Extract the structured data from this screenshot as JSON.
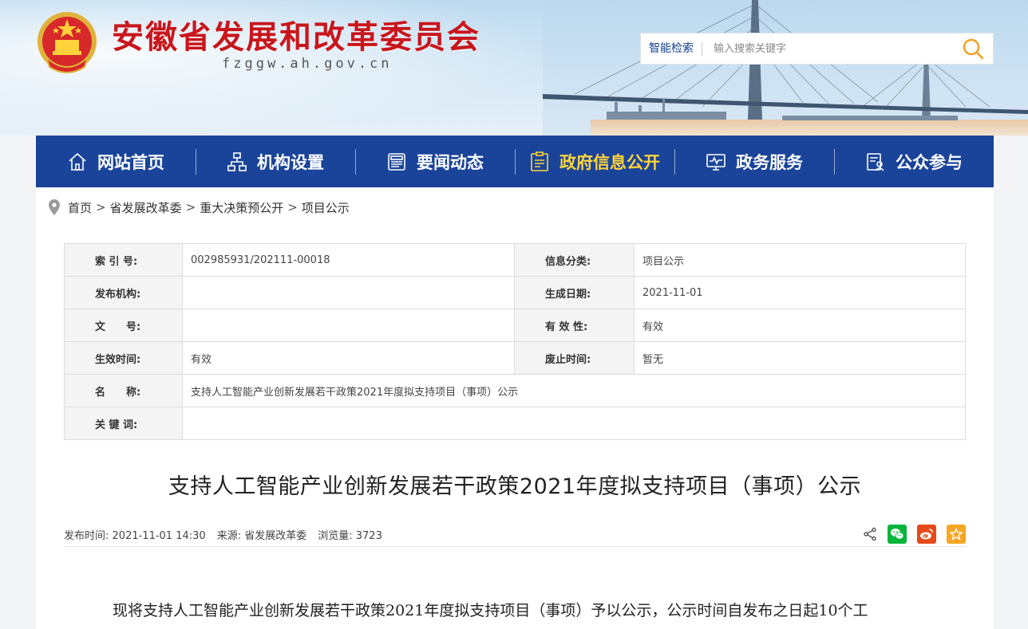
{
  "header": {
    "site_title": "安徽省发展和改革委员会",
    "site_domain": "fzggw.ah.gov.cn",
    "search": {
      "label": "智能检索",
      "placeholder": "输入搜索关键字"
    },
    "emblem_icon": "national-emblem-icon"
  },
  "nav": {
    "items": [
      {
        "label": "网站首页",
        "icon": "home-icon"
      },
      {
        "label": "机构设置",
        "icon": "org-chart-icon"
      },
      {
        "label": "要闻动态",
        "icon": "news-icon"
      },
      {
        "label": "政府信息公开",
        "icon": "info-disclosure-icon",
        "active": true
      },
      {
        "label": "政务服务",
        "icon": "service-monitor-icon"
      },
      {
        "label": "公众参与",
        "icon": "public-participation-icon"
      }
    ],
    "active_color": "#ffd43a",
    "bg_color": "#1a4499"
  },
  "breadcrumb": [
    "首页",
    "省发展改革委",
    "重大决策预公开",
    "项目公示"
  ],
  "breadcrumb_sep": ">",
  "meta": {
    "index_no_label": "索 引 号:",
    "index_no": "002985931/202111-00018",
    "category_label": "信息分类:",
    "category": "项目公示",
    "publisher_label": "发布机构:",
    "publisher": "",
    "created_label": "生成日期:",
    "created": "2021-11-01",
    "doc_no_label": "文　　号:",
    "doc_no": "",
    "validity_label": "有 效 性:",
    "validity": "有效",
    "effective_label": "生效时间:",
    "effective": "有效",
    "expiry_label": "废止时间:",
    "expiry": "暂无",
    "name_label": "名　　称:",
    "name": "支持人工智能产业创新发展若干政策2021年度拟支持项目（事项）公示",
    "keywords_label": "关 键 词:",
    "keywords": ""
  },
  "article": {
    "title": "支持人工智能产业创新发展若干政策2021年度拟支持项目（事项）公示",
    "publish_time_label": "发布时间:",
    "publish_time": "2021-11-01 14:30",
    "source_label": "来源:",
    "source": "省发展改革委",
    "views_label": "浏览量:",
    "views": "3723",
    "body_first_line": "现将支持人工智能产业创新发展若干政策2021年度拟支持项目（事项）予以公示，公示时间自发布之日起10个工"
  },
  "share": {
    "share_icon": "share-icon",
    "wechat_icon": "wechat-icon",
    "weibo_icon": "weibo-icon",
    "favorite_icon": "star-icon",
    "wechat_color": "#07b53b",
    "weibo_color": "#e64a19",
    "favorite_color": "#f5a623"
  }
}
